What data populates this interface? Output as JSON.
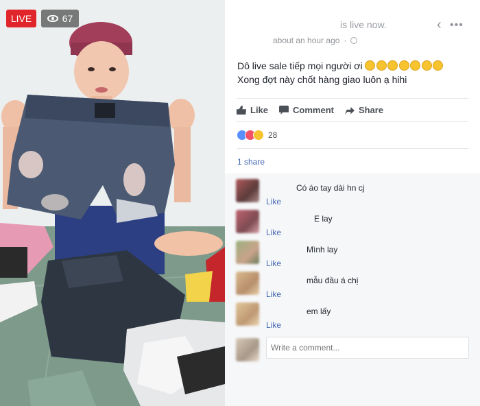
{
  "video": {
    "live_label": "LIVE",
    "viewer_count": "67"
  },
  "post": {
    "status": "is live now.",
    "timestamp": "about an hour ago",
    "text_line1": "Dô live sale tiếp mọi người ơi",
    "text_line2": "Xong đợt này chốt hàng giao luôn ạ hihi",
    "emoji_count": 7
  },
  "actions": {
    "like": "Like",
    "comment": "Comment",
    "share": "Share"
  },
  "reactions": {
    "count": "28"
  },
  "shares": "1 share",
  "comments": [
    {
      "text": "Có áo tay dài hn cj",
      "like": "Like"
    },
    {
      "text": "E lay",
      "like": "Like"
    },
    {
      "text": "Mình lay",
      "like": "Like"
    },
    {
      "text": "mẫu đầu á chị",
      "like": "Like"
    },
    {
      "text": "em lấy",
      "like": "Like"
    }
  ],
  "composer": {
    "placeholder": "Write a comment..."
  },
  "colors": {
    "live_red": "#e0262b",
    "link_blue": "#4267b2",
    "text_dark": "#1d2129"
  }
}
